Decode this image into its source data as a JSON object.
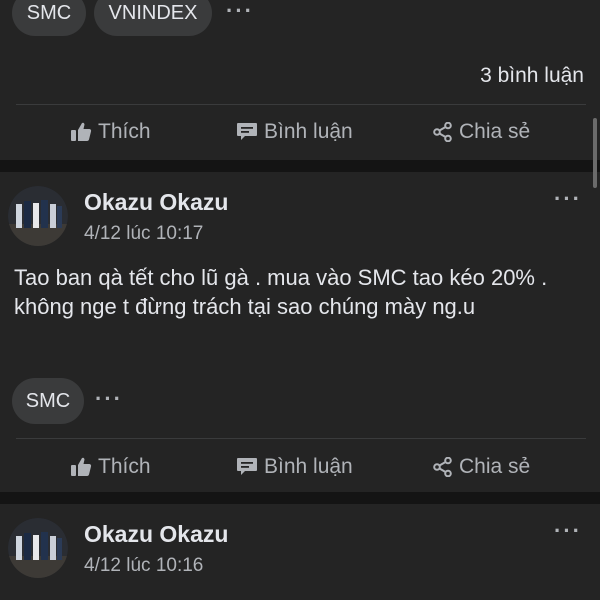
{
  "post1": {
    "tags": [
      "SMC",
      "VNINDEX"
    ],
    "more_icon": "more-horizontal-icon",
    "comments_count": "3 bình luận",
    "actions": {
      "like": "Thích",
      "comment": "Bình luận",
      "share": "Chia sẻ"
    }
  },
  "post2": {
    "author": "Okazu Okazu",
    "timestamp": "4/12 lúc 10:17",
    "text": "Tao ban  qà tết cho lũ gà . mua vào SMC  tao kéo 20% . không nge t đừng trách  tại sao chúng mày ng.u",
    "tags": [
      "SMC"
    ],
    "actions": {
      "like": "Thích",
      "comment": "Bình luận",
      "share": "Chia sẻ"
    }
  },
  "post3": {
    "author": "Okazu Okazu",
    "timestamp": "4/12 lúc 10:16"
  },
  "colors": {
    "background": "#111111",
    "card": "#242424",
    "chip": "#3a3b3c",
    "text_primary": "#e4e6eb",
    "text_secondary": "#b0b3b8"
  }
}
